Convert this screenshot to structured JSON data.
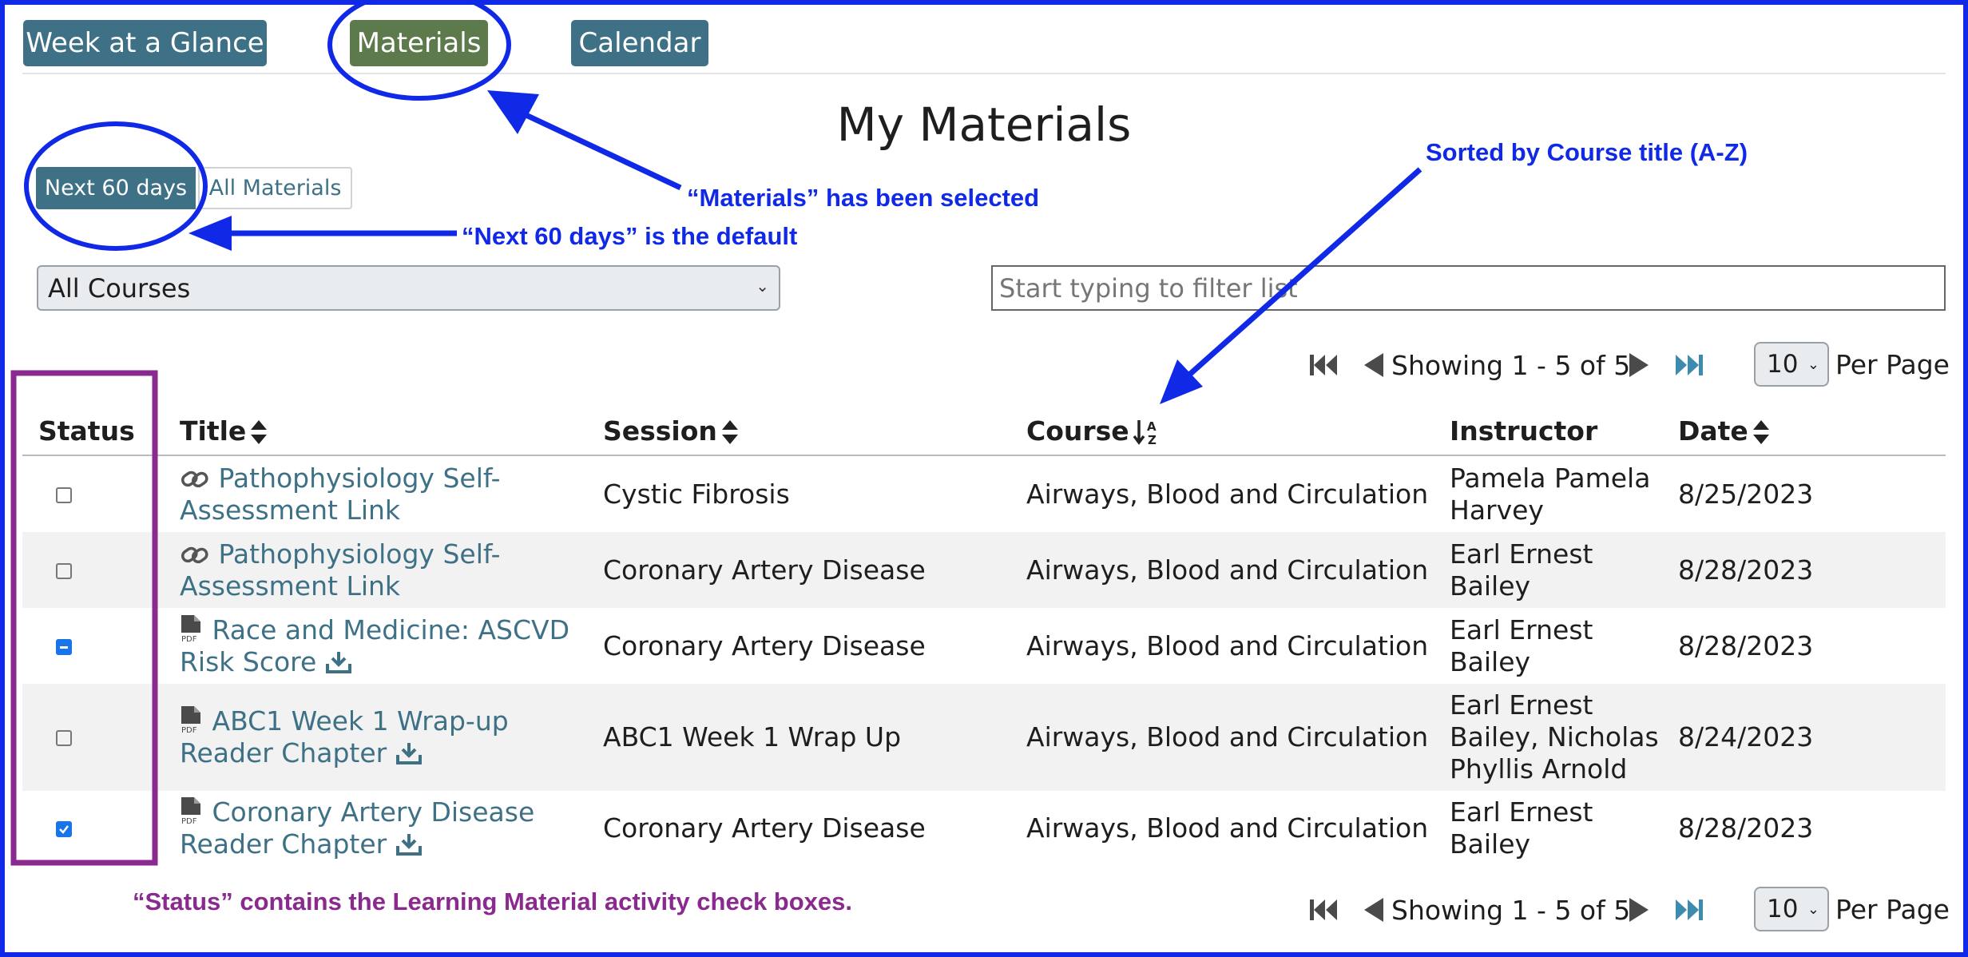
{
  "nav": {
    "week": "Week at a Glance",
    "materials": "Materials",
    "calendar": "Calendar"
  },
  "page_title": "My Materials",
  "range": {
    "next": "Next 60 days",
    "all": "All Materials"
  },
  "course_select": {
    "value": "All Courses"
  },
  "filter": {
    "placeholder": "Start typing to filter list"
  },
  "pager": {
    "text": "Showing 1 - 5 of 5",
    "per_page_value": "10",
    "per_page_label": "Per Page"
  },
  "table": {
    "headers": {
      "status": "Status",
      "title": "Title",
      "session": "Session",
      "course": "Course",
      "instructor": "Instructor",
      "date": "Date"
    },
    "rows": [
      {
        "status": "unchecked",
        "icon": "link-icon",
        "title": "Pathophysiology Self-Assessment Link",
        "session": "Cystic Fibrosis",
        "course": "Airways, Blood and Circulation",
        "instructor": "Pamela Pamela Harvey",
        "date": "8/25/2023"
      },
      {
        "status": "unchecked",
        "icon": "link-icon",
        "title": "Pathophysiology Self-Assessment Link",
        "session": "Coronary Artery Disease",
        "course": "Airways, Blood and Circulation",
        "instructor": "Earl Ernest Bailey",
        "date": "8/28/2023"
      },
      {
        "status": "indeterminate",
        "icon": "pdf-icon",
        "title": "Race and Medicine: ASCVD Risk Score",
        "session": "Coronary Artery Disease",
        "course": "Airways, Blood and Circulation",
        "instructor": "Earl Ernest Bailey",
        "date": "8/28/2023"
      },
      {
        "status": "unchecked",
        "icon": "pdf-icon",
        "title": "ABC1 Week 1 Wrap-up Reader Chapter",
        "session": "ABC1 Week 1 Wrap Up",
        "course": "Airways, Blood and Circulation",
        "instructor": "Earl Ernest Bailey, Nicholas Phyllis Arnold",
        "date": "8/24/2023"
      },
      {
        "status": "checked",
        "icon": "pdf-icon",
        "title": "Coronary Artery Disease Reader Chapter",
        "session": "Coronary Artery Disease",
        "course": "Airways, Blood and Circulation",
        "instructor": "Earl Ernest Bailey",
        "date": "8/28/2023"
      }
    ]
  },
  "annotations": {
    "materials_selected": "“Materials” has been selected",
    "next60_default": "“Next 60 days” is the default",
    "sorted": "Sorted by Course title (A-Z)",
    "status_note": "“Status” contains the Learning Material activity check boxes."
  },
  "colors": {
    "primary": "#3e7186",
    "active": "#5d7a4d",
    "annotation_blue": "#1029e6",
    "annotation_purple": "#8a2a8f"
  }
}
